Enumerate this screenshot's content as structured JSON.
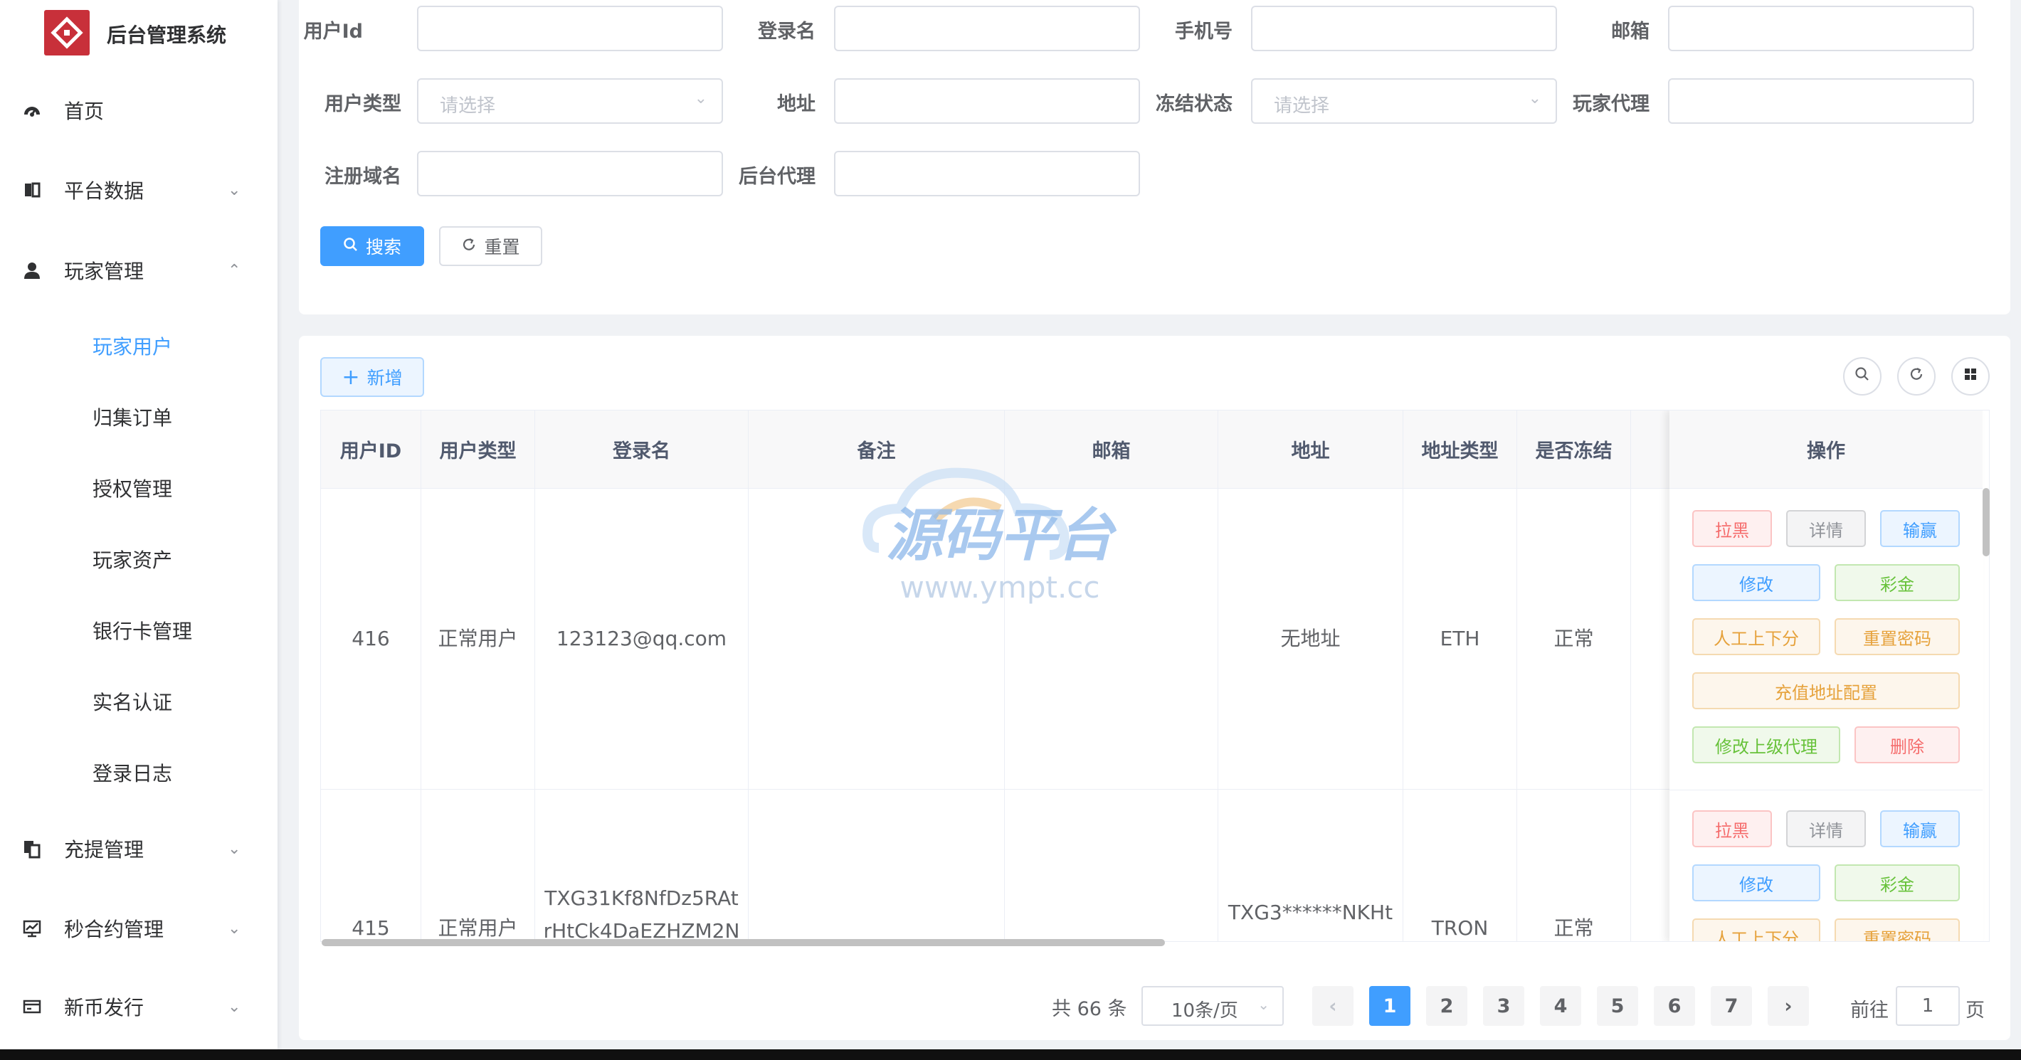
{
  "app": {
    "title": "后台管理系统"
  },
  "sidebar": {
    "items": [
      {
        "label": "首页",
        "icon": "dashboard-icon"
      },
      {
        "label": "平台数据",
        "icon": "book-icon"
      },
      {
        "label": "玩家管理",
        "icon": "user-icon"
      },
      {
        "label": "充提管理",
        "icon": "copy-icon"
      },
      {
        "label": "秒合约管理",
        "icon": "chart-icon"
      },
      {
        "label": "新币发行",
        "icon": "card-icon"
      }
    ],
    "sub_items": [
      "玩家用户",
      "归集订单",
      "授权管理",
      "玩家资产",
      "银行卡管理",
      "实名认证",
      "登录日志"
    ],
    "active_sub": "玩家用户"
  },
  "search": {
    "labels": {
      "user_id": "用户Id",
      "login_name": "登录名",
      "phone": "手机号",
      "email": "邮箱",
      "user_type": "用户类型",
      "address": "地址",
      "freeze_status": "冻结状态",
      "player_agent": "玩家代理",
      "reg_domain": "注册域名",
      "backend_agent": "后台代理"
    },
    "select_placeholder": "请选择",
    "search_button": "搜索",
    "reset_button": "重置"
  },
  "toolbar": {
    "add_button": "新增"
  },
  "table": {
    "columns": [
      "用户ID",
      "用户类型",
      "登录名",
      "备注",
      "邮箱",
      "地址",
      "地址类型",
      "是否冻结",
      "操作"
    ],
    "rows": [
      {
        "id": "416",
        "type": "正常用户",
        "login": "123123@qq.com",
        "note": "",
        "email": "",
        "address": "无地址",
        "addr_type": "ETH",
        "frozen": "正常"
      },
      {
        "id": "415",
        "type": "正常用户",
        "login_line1": "TXG31Kf8NfDz5RAt",
        "login_line2": "rHtCk4DaEZHZM2N",
        "note": "",
        "email": "",
        "address": "TXG3******NKHt",
        "addr_type": "TRON",
        "frozen": "正常"
      }
    ],
    "actions": {
      "blacklist": "拉黑",
      "detail": "详情",
      "win_lose": "输赢",
      "edit": "修改",
      "bonus": "彩金",
      "manual_score": "人工上下分",
      "reset_pwd": "重置密码",
      "recharge_addr": "充值地址配置",
      "edit_parent": "修改上级代理",
      "delete": "删除"
    }
  },
  "pagination": {
    "total": "共 66 条",
    "page_size": "10条/页",
    "pages": [
      "1",
      "2",
      "3",
      "4",
      "5",
      "6",
      "7"
    ],
    "current": "1",
    "goto_prefix": "前往",
    "goto_value": "1",
    "goto_suffix": "页"
  },
  "watermark": {
    "title": "源码平台",
    "url": "www.ympt.cc"
  },
  "colors": {
    "primary": "#409eff",
    "logo": "#c8303a",
    "danger": "#f56c6c",
    "success": "#67c23a",
    "warning": "#e6a23c"
  }
}
